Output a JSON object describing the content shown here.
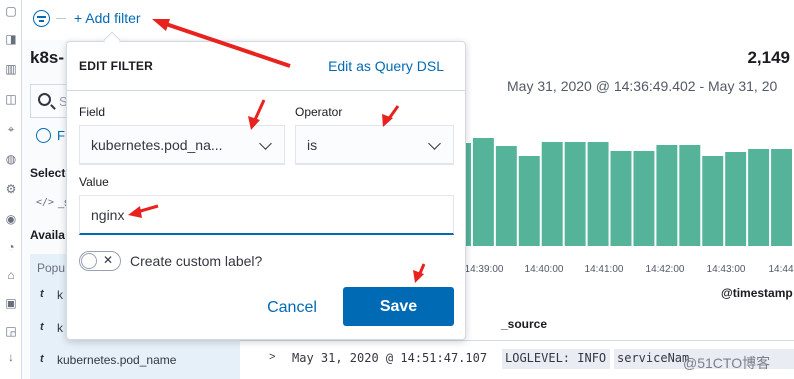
{
  "colors": {
    "accent": "#006bb4",
    "bar": "#54b399",
    "annotation": "#e8231f"
  },
  "filter_bar": {
    "add_filter_label": "+ Add filter",
    "menu_icon": "filter-menu-icon"
  },
  "sidebar": {
    "index_title": "k8s-",
    "search_placeholder": "S",
    "filter_hint": "F",
    "selected_title": "Selecte",
    "selected_field": "_s",
    "available_title": "Availa",
    "popular_label": "Popu",
    "fields": [
      {
        "type": "t",
        "name": "k"
      },
      {
        "type": "t",
        "name": "k"
      },
      {
        "type": "t",
        "name": "kubernetes.pod_name"
      }
    ]
  },
  "main": {
    "hits": "2,149",
    "time_range": "May 31, 2020 @ 14:36:49.402 - May 31, 20",
    "timestamp_label": "@timestamp",
    "source_column": "_source",
    "first_row": {
      "time": "May 31, 2020 @ 14:51:47.107",
      "kv1": "LOGLEVEL: INFO",
      "kv2": "serviceNam"
    },
    "watermark": "@51CTO博客"
  },
  "chart_data": {
    "type": "bar",
    "xlabel": "@timestamp",
    "x_ticks": [
      "14:39:00",
      "14:40:00",
      "14:41:00",
      "14:42:00",
      "14:43:00",
      "14:44"
    ],
    "values": [
      103,
      108,
      100,
      90,
      104,
      104,
      104,
      95,
      95,
      101,
      101,
      90,
      94,
      97,
      97
    ],
    "ylim": [
      0,
      126
    ]
  },
  "edit_filter": {
    "title": "EDIT FILTER",
    "edit_dsl_label": "Edit as Query DSL",
    "field_label": "Field",
    "field_value": "kubernetes.pod_na...",
    "operator_label": "Operator",
    "operator_value": "is",
    "value_label": "Value",
    "value": "nginx",
    "custom_label_toggle": "Create custom label?",
    "cancel_label": "Cancel",
    "save_label": "Save"
  }
}
